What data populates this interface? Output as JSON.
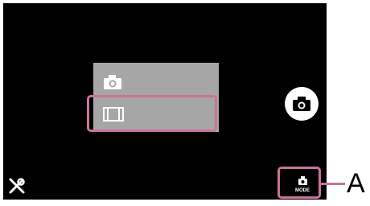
{
  "screen": {
    "background": "#000000",
    "mode_menu": {
      "items": [
        {
          "name": "still-image",
          "icon": "camera-icon"
        },
        {
          "name": "movie",
          "icon": "film-icon"
        }
      ],
      "background": "#a6a6a6",
      "selected_index": 1
    },
    "shutter_button": {
      "icon": "camera-icon"
    },
    "settings_button": {
      "icon": "tools-icon"
    },
    "mode_button": {
      "icon": "camera-icon",
      "label": "MODE"
    }
  },
  "callout": {
    "letter": "A",
    "color": "#c9739a"
  }
}
